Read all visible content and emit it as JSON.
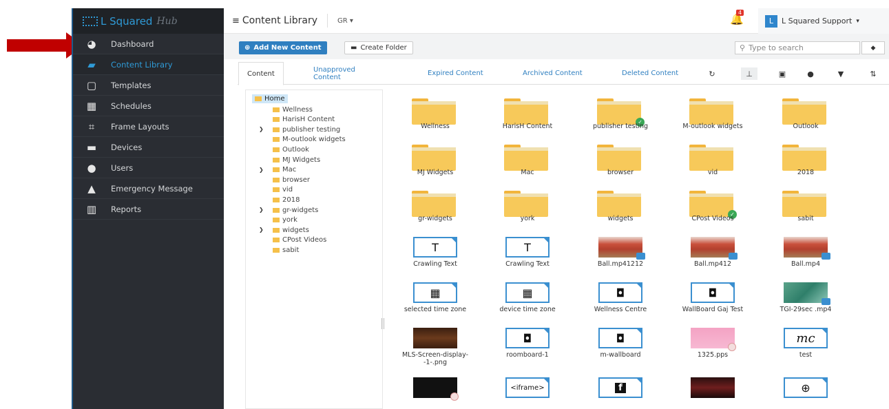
{
  "brand": {
    "name": "L Squared",
    "hub": "Hub"
  },
  "sidebar": {
    "items": [
      {
        "label": "Dashboard",
        "icon": "dashboard-icon"
      },
      {
        "label": "Content Library",
        "icon": "folder-open-icon",
        "active": true
      },
      {
        "label": "Templates",
        "icon": "template-icon"
      },
      {
        "label": "Schedules",
        "icon": "calendar-icon"
      },
      {
        "label": "Frame Layouts",
        "icon": "layout-icon"
      },
      {
        "label": "Devices",
        "icon": "device-icon"
      },
      {
        "label": "Users",
        "icon": "user-icon"
      },
      {
        "label": "Emergency Message",
        "icon": "warning-icon"
      },
      {
        "label": "Reports",
        "icon": "bar-chart-icon"
      }
    ]
  },
  "header": {
    "title": "Content Library",
    "site": "GR",
    "notifications": "4",
    "user_initial": "L",
    "user_name": "L Squared Support"
  },
  "toolbar": {
    "add_label": "Add New Content",
    "folder_label": "Create Folder",
    "search_placeholder": "Type to search"
  },
  "tabs": [
    {
      "label": "Content",
      "active": true
    },
    {
      "label": "Unapproved\nContent"
    },
    {
      "label": "Expired Content"
    },
    {
      "label": "Archived Content"
    },
    {
      "label": "Deleted Content"
    }
  ],
  "tree": {
    "root": "Home",
    "nodes": [
      {
        "label": "Wellness",
        "expandable": false
      },
      {
        "label": "HarisH Content",
        "expandable": false
      },
      {
        "label": "publisher testing",
        "expandable": true
      },
      {
        "label": "M-outlook widgets",
        "expandable": false
      },
      {
        "label": "Outlook",
        "expandable": false
      },
      {
        "label": "MJ Widgets",
        "expandable": false
      },
      {
        "label": "Mac",
        "expandable": true
      },
      {
        "label": "browser",
        "expandable": false
      },
      {
        "label": "vid",
        "expandable": false
      },
      {
        "label": "2018",
        "expandable": false
      },
      {
        "label": "gr-widgets",
        "expandable": true
      },
      {
        "label": "york",
        "expandable": false
      },
      {
        "label": "widgets",
        "expandable": true
      },
      {
        "label": "CPost Videos",
        "expandable": false
      },
      {
        "label": "sabit",
        "expandable": false
      }
    ]
  },
  "grid": {
    "folders": [
      {
        "label": "Wellness",
        "approved": false
      },
      {
        "label": "HarisH Content",
        "approved": false
      },
      {
        "label": "publisher testing",
        "approved": true
      },
      {
        "label": "M-outlook widgets",
        "approved": false
      },
      {
        "label": "Outlook",
        "approved": false
      },
      {
        "label": "MJ Widgets",
        "approved": false
      },
      {
        "label": "Mac",
        "approved": false
      },
      {
        "label": "browser",
        "approved": false
      },
      {
        "label": "vid",
        "approved": false
      },
      {
        "label": "2018",
        "approved": false
      },
      {
        "label": "gr-widgets",
        "approved": false
      },
      {
        "label": "york",
        "approved": false
      },
      {
        "label": "widgets",
        "approved": false
      },
      {
        "label": "CPost Videos",
        "approved": true
      },
      {
        "label": "sabit",
        "approved": false
      }
    ],
    "files": [
      {
        "label": "Crawling Text",
        "kind": "text-icon",
        "glyph": "T"
      },
      {
        "label": "Crawling Text",
        "kind": "text-icon",
        "glyph": "T"
      },
      {
        "label": "Ball.mp41212",
        "kind": "video-thumb"
      },
      {
        "label": "Ball.mp412",
        "kind": "video-thumb"
      },
      {
        "label": "Ball.mp4",
        "kind": "video-thumb"
      },
      {
        "label": "selected time zone",
        "kind": "calendar-clock-icon",
        "glyph": "▦"
      },
      {
        "label": "device time zone",
        "kind": "calendar-clock-icon",
        "glyph": "▦"
      },
      {
        "label": "Wellness Centre",
        "kind": "widget-icon",
        "glyph": "◘"
      },
      {
        "label": "WallBoard Gaj Test",
        "kind": "widget-icon",
        "glyph": "◘"
      },
      {
        "label": "TGI-29sec .mp4",
        "kind": "video-thumb-green"
      },
      {
        "label": "MLS-Screen-display--1-.png",
        "kind": "image-thumb"
      },
      {
        "label": "roomboard-1",
        "kind": "widget-icon",
        "glyph": "◘"
      },
      {
        "label": "m-wallboard",
        "kind": "widget-icon",
        "glyph": "◘"
      },
      {
        "label": "1325.pps",
        "kind": "slides-thumb"
      },
      {
        "label": "test",
        "kind": "logo-icon",
        "glyph": "mc"
      },
      {
        "label": "",
        "kind": "pdf-thumb"
      },
      {
        "label": "",
        "kind": "iframe-icon",
        "glyph": "<iframe>"
      },
      {
        "label": "",
        "kind": "facebook-icon",
        "glyph": "f"
      },
      {
        "label": "",
        "kind": "poster-thumb"
      },
      {
        "label": "",
        "kind": "globe-icon",
        "glyph": "⊕"
      }
    ]
  }
}
